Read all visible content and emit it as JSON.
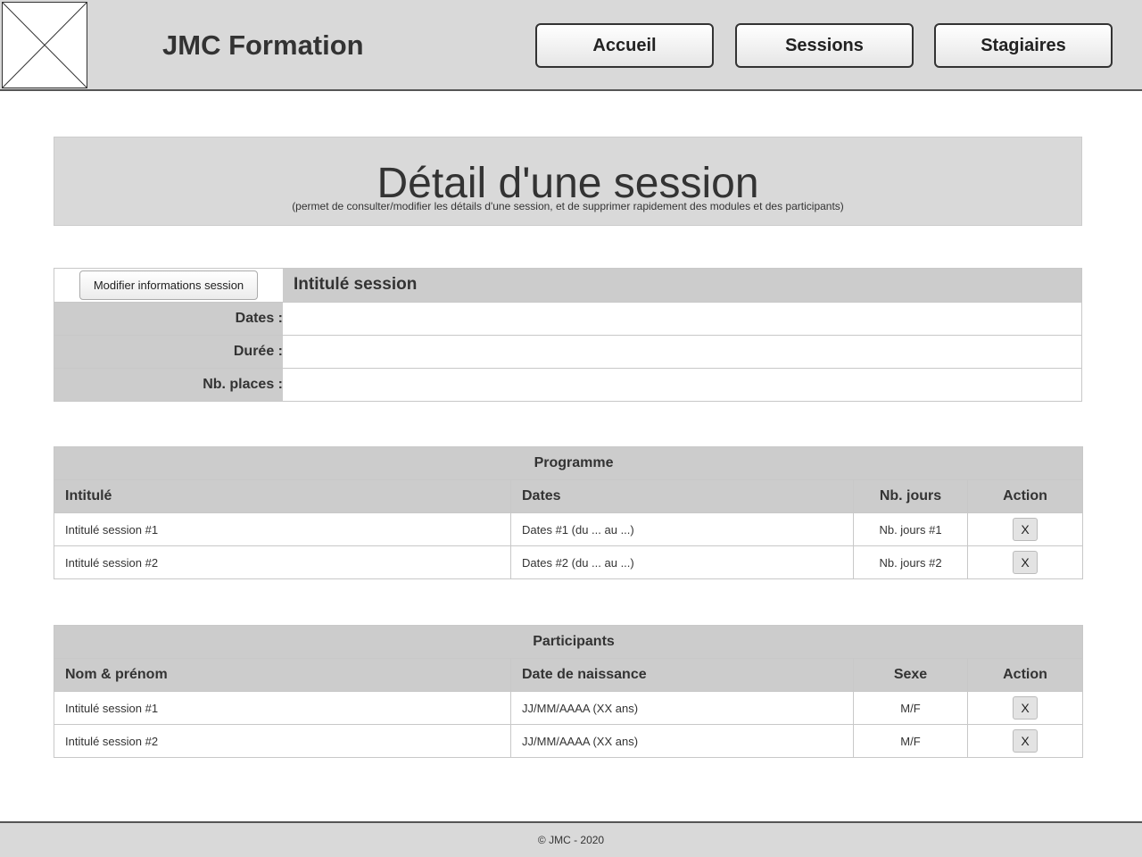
{
  "header": {
    "brand": "JMC Formation",
    "logo_icon": "image-placeholder-icon",
    "nav": [
      {
        "label": "Accueil"
      },
      {
        "label": "Sessions"
      },
      {
        "label": "Stagiaires"
      }
    ]
  },
  "title_panel": {
    "title": "Détail d'une session",
    "subtitle": "(permet de consulter/modifier les détails d'une session, et de supprimer rapidement des modules et des participants)"
  },
  "info": {
    "modify_button": "Modifier informations session",
    "session_title": "Intitulé session",
    "rows": [
      {
        "label": "Dates :",
        "value": ""
      },
      {
        "label": "Durée :",
        "value": ""
      },
      {
        "label": "Nb. places :",
        "value": ""
      }
    ]
  },
  "programme": {
    "caption": "Programme",
    "headers": [
      "Intitulé",
      "Dates",
      "Nb. jours",
      "Action"
    ],
    "rows": [
      {
        "intitule": "Intitulé session #1",
        "dates": "Dates #1 (du ... au ...)",
        "jours": "Nb. jours #1",
        "action": "X"
      },
      {
        "intitule": "Intitulé session #2",
        "dates": "Dates #2 (du ... au ...)",
        "jours": "Nb. jours #2",
        "action": "X"
      }
    ]
  },
  "participants": {
    "caption": "Participants",
    "headers": [
      "Nom & prénom",
      "Date de naissance",
      "Sexe",
      "Action"
    ],
    "rows": [
      {
        "nom": "Intitulé session #1",
        "naissance": "JJ/MM/AAAA (XX ans)",
        "sexe": "M/F",
        "action": "X"
      },
      {
        "nom": "Intitulé session #2",
        "naissance": "JJ/MM/AAAA (XX ans)",
        "sexe": "M/F",
        "action": "X"
      }
    ]
  },
  "footer": {
    "text": "© JMC - 2020"
  }
}
